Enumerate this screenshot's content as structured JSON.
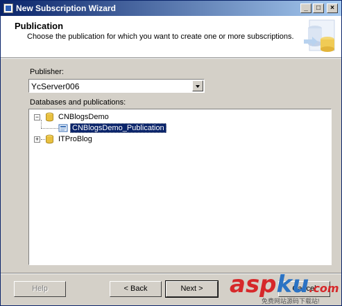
{
  "window": {
    "title": "New Subscription Wizard",
    "controls": {
      "minimize": "_",
      "maximize": "□",
      "close": "×"
    }
  },
  "header": {
    "title": "Publication",
    "subtitle": "Choose the publication for which you want to create one or more subscriptions."
  },
  "publisher": {
    "label": "Publisher:",
    "selected": "YcServer006"
  },
  "tree": {
    "label": "Databases and publications:",
    "nodes": [
      {
        "label": "CNBlogsDemo",
        "expanded": true,
        "icon": "database-icon"
      },
      {
        "label": "CNBlogsDemo_Publication",
        "selected": true,
        "icon": "publication-icon"
      },
      {
        "label": "ITProBlog",
        "expanded": false,
        "icon": "database-icon"
      }
    ]
  },
  "buttons": {
    "help": "Help",
    "back": "< Back",
    "next": "Next >",
    "cancel": "Cancel"
  },
  "watermark": {
    "text_a": "asp",
    "text_b": "ku",
    "text_c": ".com",
    "subtext": "免费网站源码下载站!"
  },
  "colors": {
    "titlebar": "#0a246a",
    "selection": "#0a246a",
    "window_bg": "#d4d0c8",
    "watermark_red": "#d6282a"
  }
}
